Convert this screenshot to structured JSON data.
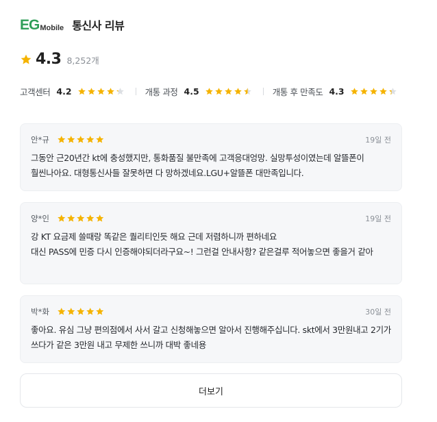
{
  "header": {
    "logo_mark": "EG",
    "logo_sub": "Mobile",
    "title": "통신사 리뷰"
  },
  "summary": {
    "rating": "4.3",
    "count": "8,252개",
    "star_color": "#f5b300"
  },
  "subratings": [
    {
      "label": "고객센터",
      "value": "4.2",
      "score": 4.2
    },
    {
      "label": "개통 과정",
      "value": "4.5",
      "score": 4.5
    },
    {
      "label": "개통 후 만족도",
      "value": "4.3",
      "score": 4.3
    }
  ],
  "reviews": [
    {
      "name": "안*규",
      "date": "19일 전",
      "stars": 5,
      "text": "그동안 근20년간 kt에 충성했지만, 통화품질 불만족에 고객응대엉망. 실망투성이였는데 알뜰폰이 훨씬나아요. 대형통신사들 잘못하면 다 망하겠네요.LGU+알뜰폰 대만족입니다."
    },
    {
      "name": "양*인",
      "date": "19일 전",
      "stars": 5,
      "text": "강 KT 요금제 쓸때랑 똑같은 퀄리티인듯 해요 근데 저렴하니까 편하네요\n대신 PASS에 민증 다시 인증해야되더라구요~! 그런걸 안내사항? 같은걸루 적어놓으면 좋을거 같아"
    },
    {
      "name": "박*화",
      "date": "30일 전",
      "stars": 5,
      "text": "좋아요. 유심 그냥 편의점에서 사서 갈고 신청해놓으면 알아서 진행해주십니다. skt에서 3만원내고 2기가 쓰다가 같은 3만원 내고 무제한 쓰니까 대박 좋네용"
    }
  ],
  "more_label": "더보기"
}
